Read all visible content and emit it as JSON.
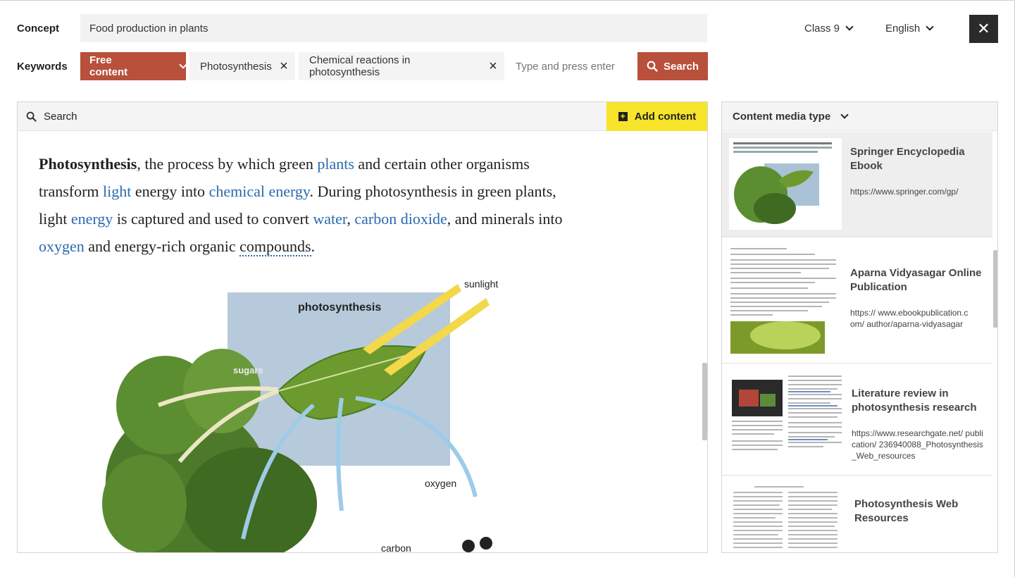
{
  "concept": {
    "label": "Concept",
    "value": "Food production in plants"
  },
  "class_select": {
    "value": "Class 9"
  },
  "language_select": {
    "value": "English"
  },
  "keywords": {
    "label": "Keywords",
    "filter": "Free content",
    "chips": [
      "Photosynthesis",
      "Chemical reactions in photosynthesis"
    ],
    "placeholder": "Type and press enter",
    "search_label": "Search"
  },
  "left": {
    "search_label": "Search",
    "add_label": "Add content",
    "article": {
      "t0": "Photosynthesis",
      "t1": ", the process by which green ",
      "l1": "plants",
      "t2": " and certain other organisms transform ",
      "l2": "light",
      "t3": " energy into ",
      "l3": "chemical energy",
      "t4": ". During photosynthesis in green plants, light ",
      "l4": "energy",
      "t5": " is captured and used to convert ",
      "l5": "water",
      "t6": ", ",
      "l6": "carbon dioxide",
      "t7": ", and minerals into ",
      "l7": "oxygen",
      "t8": " and energy-rich organic ",
      "l8": "compounds",
      "t9": "."
    },
    "diagram": {
      "photosynthesis": "photosynthesis",
      "sunlight": "sunlight",
      "sugars": "sugars",
      "oxygen": "oxygen",
      "carbon": "carbon"
    }
  },
  "right": {
    "header": "Content media type",
    "cards": [
      {
        "title": "Springer Encyclopedia Ebook",
        "url": "https://www.springer.com/gp/"
      },
      {
        "title": "Aparna Vidyasagar Online Publication",
        "url": "https:// www.ebookpublication.com/ author/aparna-vidyasagar"
      },
      {
        "title": "Literature review in photosynthesis research",
        "url": "https://www.researchgate.net/ publication/ 236940088_Photosynthesis_Web_resources"
      },
      {
        "title": "Photosynthesis Web Resources",
        "url": ""
      }
    ]
  },
  "icons": {
    "close": "close-icon",
    "search": "search-icon",
    "add": "plus-icon",
    "chevron": "chevron-down-icon"
  },
  "colors": {
    "accent": "#b8503b",
    "add": "#f7e42b",
    "link": "#2a6ab0",
    "dark": "#2b2b2b"
  }
}
